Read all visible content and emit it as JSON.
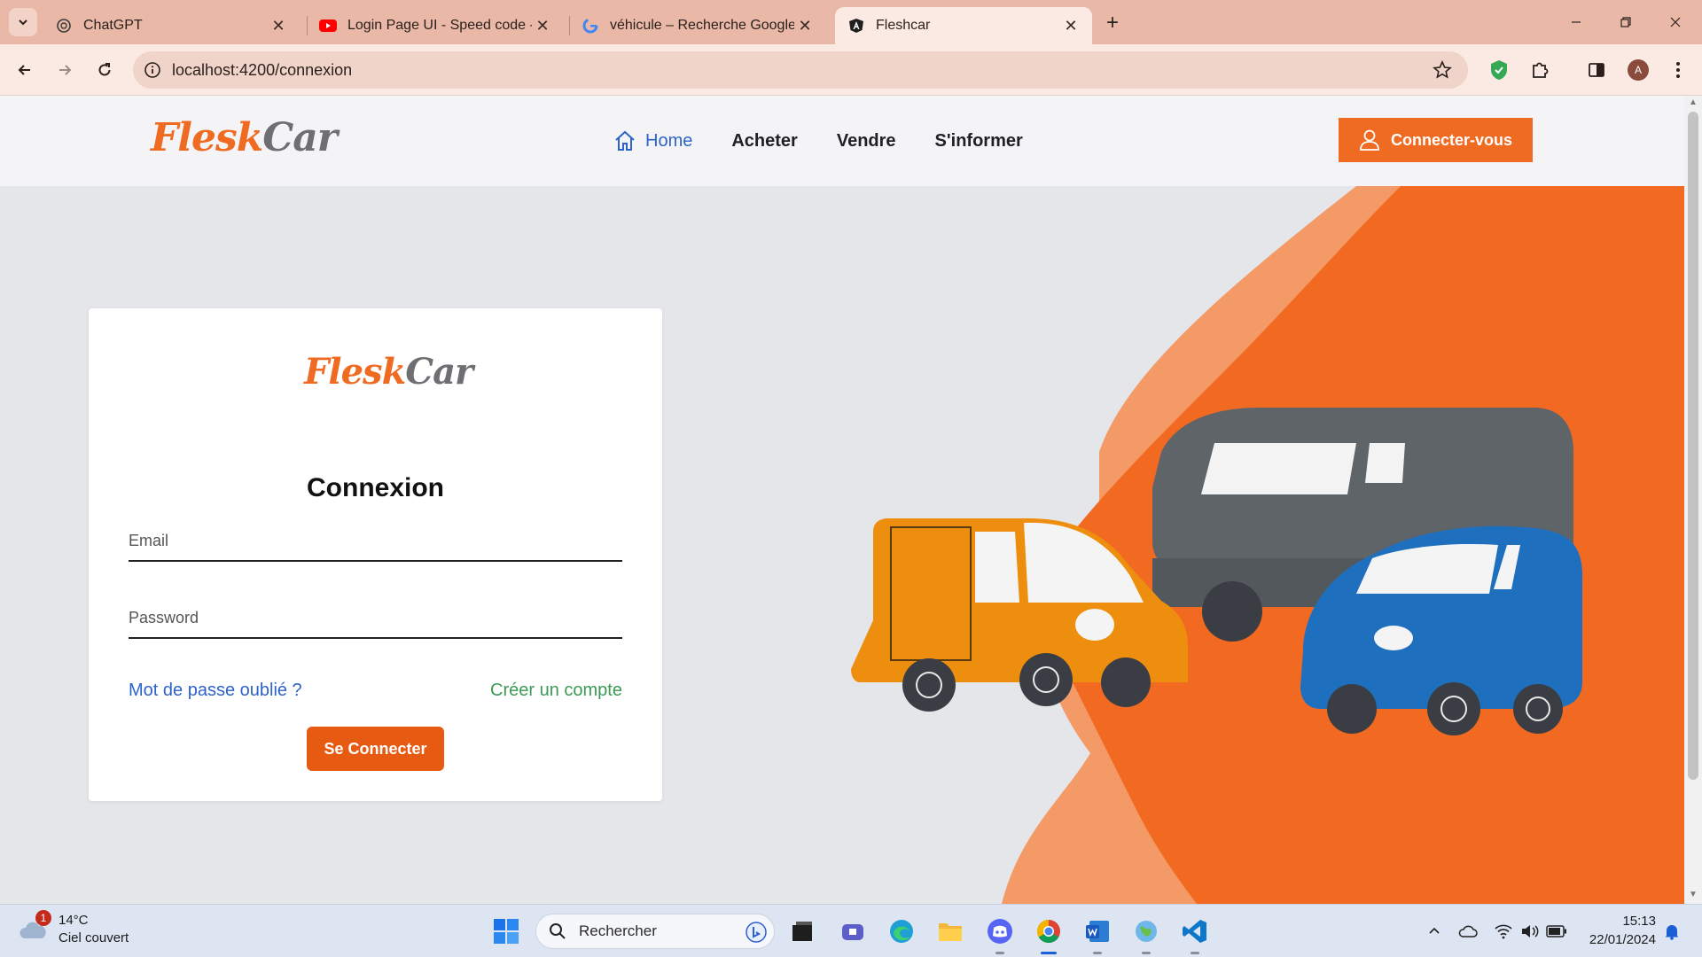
{
  "browser": {
    "tabs": [
      {
        "title": "ChatGPT",
        "icon": "chatgpt-icon"
      },
      {
        "title": "Login Page UI - Speed code - re",
        "icon": "youtube-icon"
      },
      {
        "title": "véhicule – Recherche Google",
        "icon": "google-icon"
      },
      {
        "title": "Fleshcar",
        "icon": "angular-icon",
        "active": true
      }
    ],
    "url": "localhost:4200/connexion",
    "profile_initial": "A"
  },
  "site": {
    "logo_part1": "Flesk",
    "logo_part2": "Car",
    "nav": [
      {
        "label": "Home",
        "active": true
      },
      {
        "label": "Acheter"
      },
      {
        "label": "Vendre"
      },
      {
        "label": "S'informer"
      }
    ],
    "cta_label": "Connecter-vous"
  },
  "login": {
    "logo_part1": "Flesk",
    "logo_part2": "Car",
    "heading": "Connexion",
    "email_placeholder": "Email",
    "password_placeholder": "Password",
    "forgot_label": "Mot de passe oublié ?",
    "create_label": "Créer un compte",
    "submit_label": "Se Connecter"
  },
  "colors": {
    "accent": "#f06b22",
    "link_blue": "#2d63c8",
    "link_green": "#3a9a56",
    "button": "#e65a12"
  },
  "taskbar": {
    "weather_temp": "14°C",
    "weather_desc": "Ciel couvert",
    "weather_badge": "1",
    "search_placeholder": "Rechercher",
    "time": "15:13",
    "date": "22/01/2024"
  }
}
